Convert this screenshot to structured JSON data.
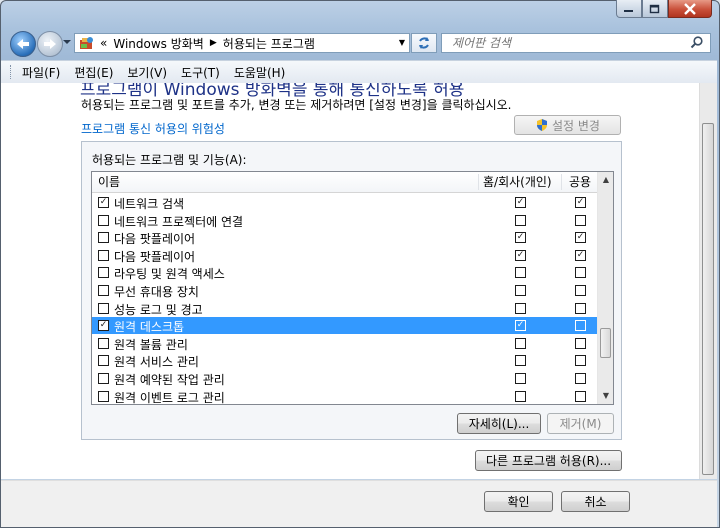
{
  "window": {
    "minimize_icon": "minimize-icon",
    "maximize_icon": "maximize-icon",
    "close_icon": "close-icon"
  },
  "nav": {
    "back_icon": "back-arrow-icon",
    "forward_icon": "forward-arrow-icon",
    "dropdown_icon": "chevron-down-icon"
  },
  "address": {
    "overflow": "«",
    "crumbs": [
      "Windows 방화벽",
      "허용되는 프로그램"
    ],
    "separator": "▶",
    "dropdown": "▼"
  },
  "search": {
    "placeholder": "제어판 검색",
    "icon": "search-icon"
  },
  "menu": [
    "파일(F)",
    "편집(E)",
    "보기(V)",
    "도구(T)",
    "도움말(H)"
  ],
  "content": {
    "cut_title": "프로그램이 Windows 방화벽을 통해 통신하도록 허용",
    "description": "허용되는 프로그램 및 포트를 추가, 변경 또는 제거하려면 [설정 변경]을 클릭하십시오.",
    "risk_link": "프로그램 통신 허용의 위험성",
    "change_settings": "설정 변경",
    "list_label": "허용되는 프로그램 및 기능(A):"
  },
  "table": {
    "headers": {
      "name": "이름",
      "home": "홈/회사(개인)",
      "public": "공용"
    },
    "rows": [
      {
        "name": "네트워크 검색",
        "checked": true,
        "home": true,
        "public": true,
        "selected": false
      },
      {
        "name": "네트워크 프로젝터에 연결",
        "checked": false,
        "home": false,
        "public": false,
        "selected": false
      },
      {
        "name": "다음 팟플레이어",
        "checked": false,
        "home": true,
        "public": true,
        "selected": false
      },
      {
        "name": "다음 팟플레이어",
        "checked": false,
        "home": true,
        "public": true,
        "selected": false
      },
      {
        "name": "라우팅 및 원격 액세스",
        "checked": false,
        "home": false,
        "public": false,
        "selected": false
      },
      {
        "name": "무선 휴대용 장치",
        "checked": false,
        "home": false,
        "public": false,
        "selected": false
      },
      {
        "name": "성능 로그 및 경고",
        "checked": false,
        "home": false,
        "public": false,
        "selected": false
      },
      {
        "name": "원격 데스크톱",
        "checked": true,
        "home": true,
        "public": false,
        "selected": true
      },
      {
        "name": "원격 볼륨 관리",
        "checked": false,
        "home": false,
        "public": false,
        "selected": false
      },
      {
        "name": "원격 서비스 관리",
        "checked": false,
        "home": false,
        "public": false,
        "selected": false
      },
      {
        "name": "원격 예약된 작업 관리",
        "checked": false,
        "home": false,
        "public": false,
        "selected": false
      },
      {
        "name": "원격 이벤트 로그 관리",
        "checked": false,
        "home": false,
        "public": false,
        "selected": false
      }
    ]
  },
  "buttons": {
    "details": "자세히(L)...",
    "remove": "제거(M)",
    "allow_other": "다른 프로그램 허용(R)...",
    "ok": "확인",
    "cancel": "취소"
  }
}
